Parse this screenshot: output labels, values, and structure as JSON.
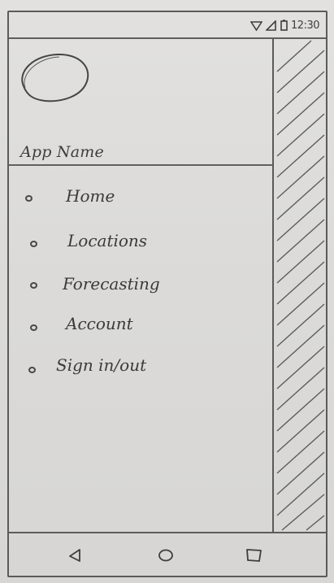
{
  "status_bar": {
    "time": "12:30",
    "icons": [
      "wifi-icon",
      "signal-icon",
      "battery-icon"
    ]
  },
  "drawer": {
    "header": {
      "avatar_icon": "avatar-placeholder",
      "app_name": "App Name"
    },
    "menu_items": [
      {
        "label": "Home"
      },
      {
        "label": "Locations"
      },
      {
        "label": "Forecasting"
      },
      {
        "label": "Account"
      },
      {
        "label": "Sign in/out"
      }
    ]
  },
  "navigation_bar": {
    "buttons": [
      "back-icon",
      "home-icon",
      "recents-icon"
    ]
  },
  "colors": {
    "paper": "#dcdbd9",
    "pencil": "#4a4a4a"
  }
}
